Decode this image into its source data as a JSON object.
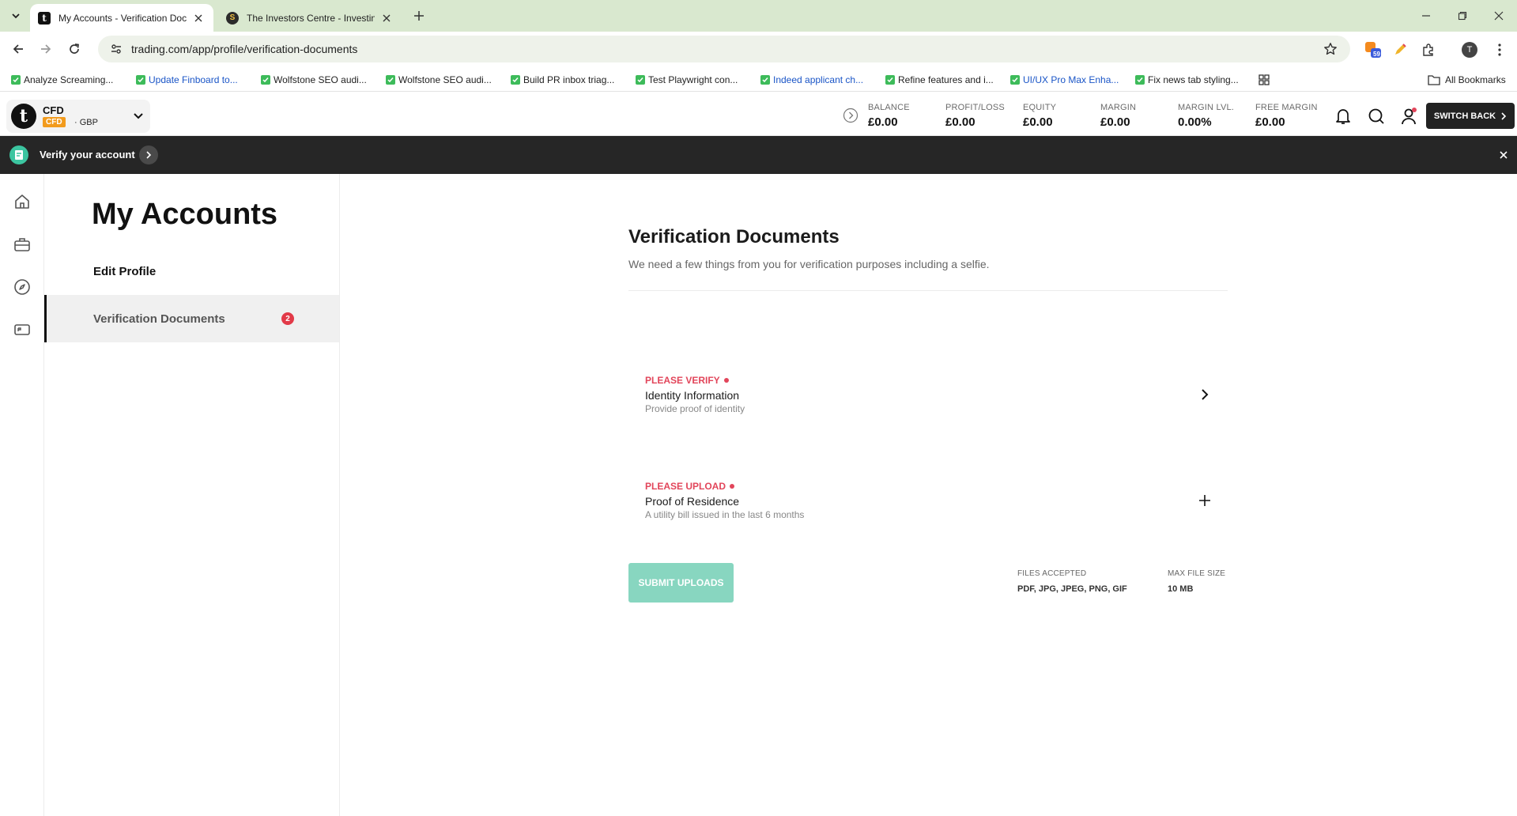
{
  "browser": {
    "tabs": [
      {
        "title": "My Accounts - Verification Doc",
        "favicon": "t",
        "active": true
      },
      {
        "title": "The Investors Centre - Investing",
        "favicon": "S",
        "active": false
      }
    ],
    "address": "trading.com/app/profile/verification-documents",
    "extension_badge": "59",
    "profile_initial": "T",
    "bookmarks": [
      {
        "label": "Analyze Screaming..."
      },
      {
        "label": "Update Finboard to..."
      },
      {
        "label": "Wolfstone SEO audi..."
      },
      {
        "label": "Wolfstone SEO audi..."
      },
      {
        "label": "Build PR inbox triag..."
      },
      {
        "label": "Test Playwright con..."
      },
      {
        "label": "Indeed applicant ch..."
      },
      {
        "label": "Refine features and i..."
      },
      {
        "label": "UI/UX Pro Max Enha..."
      },
      {
        "label": "Fix news tab styling..."
      }
    ],
    "all_bookmarks": "All Bookmarks"
  },
  "header": {
    "account": {
      "name": "CFD",
      "tag": "CFD",
      "currency": "· GBP",
      "logo": "t"
    },
    "stats": [
      {
        "label": "BALANCE",
        "value": "£0.00"
      },
      {
        "label": "PROFIT/LOSS",
        "value": "£0.00"
      },
      {
        "label": "EQUITY",
        "value": "£0.00"
      },
      {
        "label": "MARGIN",
        "value": "£0.00"
      },
      {
        "label": "MARGIN LVL.",
        "value": "0.00%"
      },
      {
        "label": "FREE MARGIN",
        "value": "£0.00"
      }
    ],
    "switch_back": "SWITCH BACK"
  },
  "banner": {
    "text": "Verify your account"
  },
  "sidebar": {
    "title": "My Accounts",
    "items": [
      {
        "label": "Edit Profile"
      },
      {
        "label": "Verification Documents",
        "badge": "2"
      }
    ]
  },
  "main": {
    "title": "Verification Documents",
    "subtitle": "We need a few things from you for verification purposes including a selfie.",
    "documents": [
      {
        "status": "PLEASE VERIFY",
        "name": "Identity Information",
        "desc": "Provide proof of identity",
        "action": "chevron-right-icon"
      },
      {
        "status": "PLEASE UPLOAD",
        "name": "Proof of Residence",
        "desc": "A utility bill issued in the last 6 months",
        "action": "plus-icon"
      }
    ],
    "submit_label": "SUBMIT UPLOADS",
    "files_accepted": {
      "label": "FILES ACCEPTED",
      "value": "PDF, JPG, JPEG, PNG, GIF"
    },
    "max_file_size": {
      "label": "MAX FILE SIZE",
      "value": "10 MB"
    }
  },
  "colors": {
    "accent_teal": "#88d6c0",
    "status_red": "#e2455a",
    "badge_red": "#e23a48",
    "cfd_orange": "#f29b1d",
    "banner_bg": "#262626"
  }
}
